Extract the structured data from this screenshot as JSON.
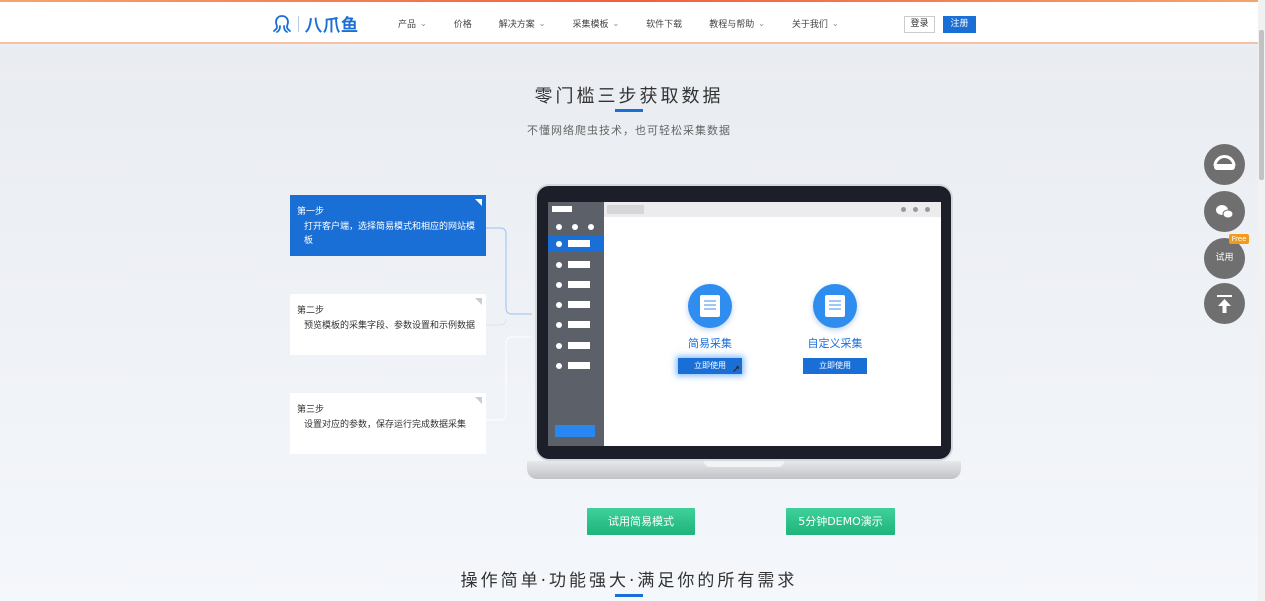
{
  "header": {
    "logo_text": "八爪鱼",
    "nav": [
      {
        "label": "产品",
        "dropdown": true
      },
      {
        "label": "价格",
        "dropdown": false
      },
      {
        "label": "解决方案",
        "dropdown": true
      },
      {
        "label": "采集模板",
        "dropdown": true
      },
      {
        "label": "软件下载",
        "dropdown": false
      },
      {
        "label": "教程与帮助",
        "dropdown": true
      },
      {
        "label": "关于我们",
        "dropdown": true
      }
    ],
    "login_label": "登录",
    "register_label": "注册"
  },
  "hero": {
    "title": "零门槛三步获取数据",
    "subtitle": "不懂网络爬虫技术，也可轻松采集数据"
  },
  "steps": [
    {
      "title": "第一步",
      "desc": "打开客户端，选择简易模式和相应的网站模板",
      "active": true
    },
    {
      "title": "第二步",
      "desc": "预览模板的采集字段、参数设置和示例数据",
      "active": false
    },
    {
      "title": "第三步",
      "desc": "设置对应的参数，保存运行完成数据采集",
      "active": false
    }
  ],
  "laptop": {
    "simple_mode_label": "简易采集",
    "custom_mode_label": "自定义采集",
    "use_now_label": "立即使用"
  },
  "actions": {
    "try_simple_label": "试用简易模式",
    "demo_label": "5分钟DEMO演示"
  },
  "section2": {
    "title": "操作简单·功能强大·满足你的所有需求"
  },
  "float_bar": {
    "trial_label": "试用",
    "free_badge": "Free"
  },
  "colors": {
    "brand": "#1a6fd6",
    "green": "#1eb47a",
    "orange": "#f29a1a"
  }
}
